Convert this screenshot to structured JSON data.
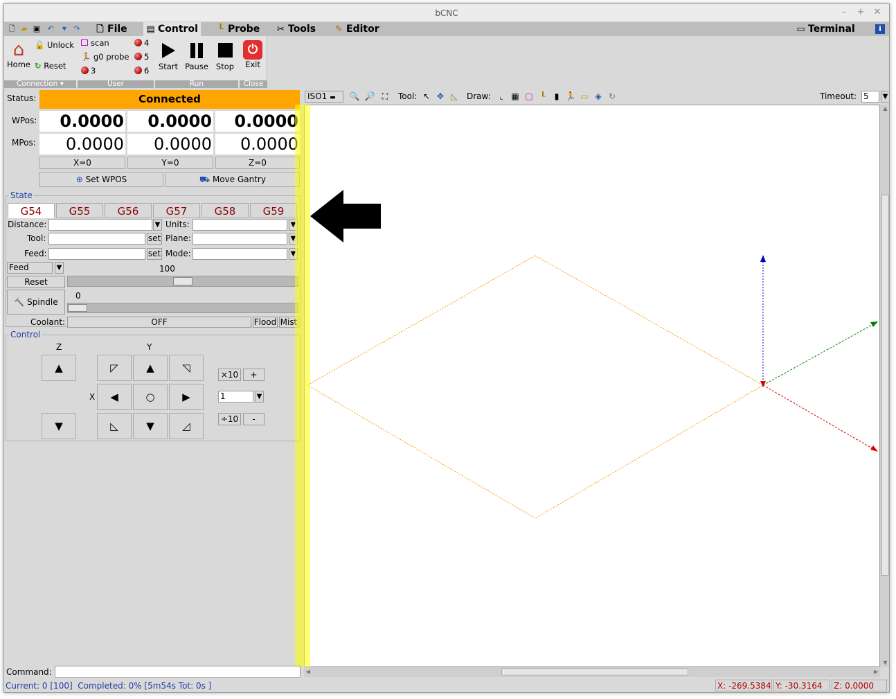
{
  "window": {
    "title": "bCNC"
  },
  "menu": {
    "tabs": [
      {
        "label": "File",
        "icon": "file-icon"
      },
      {
        "label": "Control",
        "icon": "control-icon"
      },
      {
        "label": "Probe",
        "icon": "probe-icon"
      },
      {
        "label": "Tools",
        "icon": "tools-icon"
      },
      {
        "label": "Editor",
        "icon": "editor-icon"
      }
    ],
    "active_tab": "Control",
    "terminal_label": "Terminal"
  },
  "ribbon": {
    "connection": {
      "home": "Home",
      "unlock": "Unlock",
      "reset": "Reset",
      "group_label": "Connection"
    },
    "user": {
      "scan": "scan",
      "g0probe": "g0 probe",
      "b3": "3",
      "b4": "4",
      "b5": "5",
      "b6": "6",
      "group_label": "User"
    },
    "run": {
      "start": "Start",
      "pause": "Pause",
      "stop": "Stop",
      "group_label": "Run"
    },
    "close": {
      "exit": "Exit",
      "group_label": "Close"
    }
  },
  "status": {
    "label": "Status:",
    "value": "Connected",
    "color": "#ffa500",
    "wpos_label": "WPos:",
    "mpos_label": "MPos:",
    "wpos": [
      "0.0000",
      "0.0000",
      "0.0000"
    ],
    "mpos": [
      "0.0000",
      "0.0000",
      "0.0000"
    ],
    "zero_buttons": [
      "X=0",
      "Y=0",
      "Z=0"
    ],
    "set_wpos": "Set WPOS",
    "move_gantry": "Move Gantry"
  },
  "state": {
    "title": "State",
    "wcs_tabs": [
      "G54",
      "G55",
      "G56",
      "G57",
      "G58",
      "G59"
    ],
    "active_wcs": "G54",
    "distance_label": "Distance:",
    "units_label": "Units:",
    "tool_label": "Tool:",
    "plane_label": "Plane:",
    "feed_label": "Feed:",
    "mode_label": "Mode:",
    "set_label": "set",
    "feed_override_select": "Feed",
    "feed_override_value": "100",
    "feed_override_fraction": 0.5,
    "reset_label": "Reset",
    "spindle_label": "Spindle",
    "spindle_value": "0",
    "spindle_fraction": 0.0,
    "coolant_label": "Coolant:",
    "coolant_value": "OFF",
    "flood_label": "Flood",
    "mist_label": "Mist"
  },
  "control": {
    "title": "Control",
    "z_label": "Z",
    "y_label": "Y",
    "x_label": "X",
    "step_mult": "×10",
    "step_div": "÷10",
    "plus": "+",
    "minus": "-",
    "step_value": "1"
  },
  "canvas_toolbar": {
    "view": "ISO1",
    "tool_label": "Tool:",
    "draw_label": "Draw:",
    "timeout_label": "Timeout:",
    "timeout_value": "5"
  },
  "command": {
    "label": "Command:"
  },
  "statusbar": {
    "progress_text": "Current: 0 [100]  Completed: 0% [5m54s Tot: 0s ]",
    "x": "X: -269.5384",
    "y": "Y: -30.3164",
    "z": "Z: 0.0000"
  }
}
